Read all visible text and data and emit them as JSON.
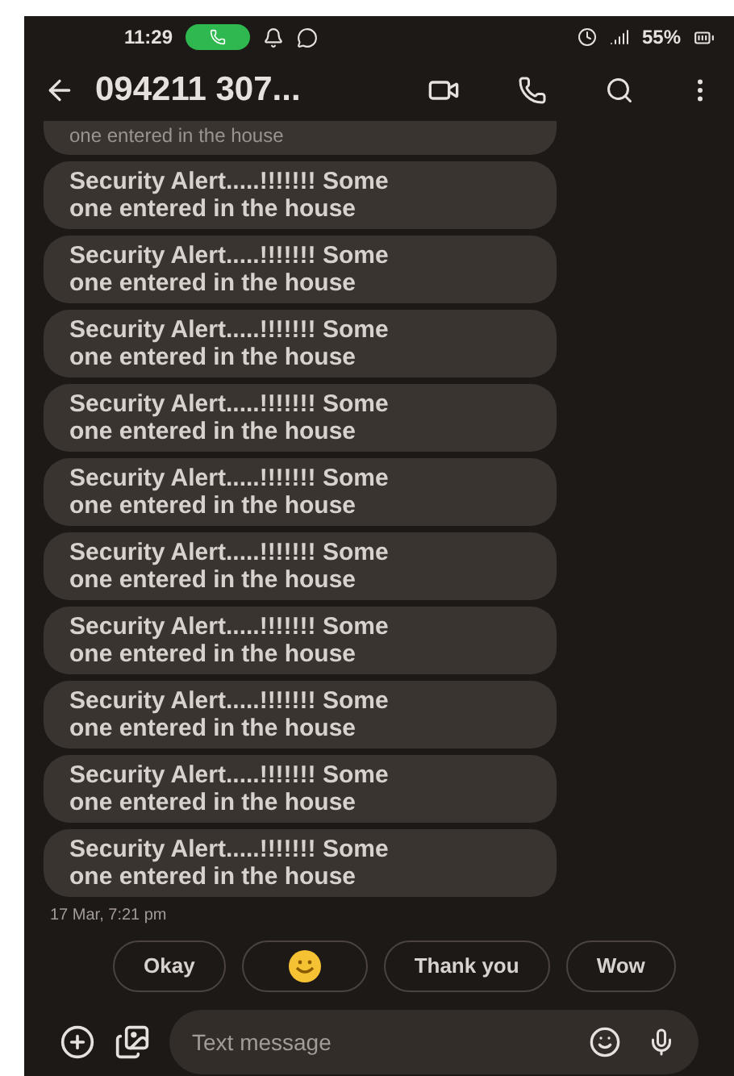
{
  "status_bar": {
    "time": "11:29",
    "battery": "55%"
  },
  "header": {
    "title": "094211 307..."
  },
  "messages": [
    {
      "text": "one entered in the house",
      "kind": "partial"
    },
    {
      "text": "Security Alert.....!!!!!!! Some one entered in the house",
      "kind": "full"
    },
    {
      "text": "Security Alert.....!!!!!!! Some one entered in the house",
      "kind": "full"
    },
    {
      "text": "Security Alert.....!!!!!!! Some one entered in the house",
      "kind": "full"
    },
    {
      "text": "Security Alert.....!!!!!!! Some one entered in the house",
      "kind": "full"
    },
    {
      "text": "Security Alert.....!!!!!!! Some one entered in the house",
      "kind": "full"
    },
    {
      "text": "Security Alert.....!!!!!!! Some one entered in the house",
      "kind": "full"
    },
    {
      "text": "Security Alert.....!!!!!!! Some one entered in the house",
      "kind": "full"
    },
    {
      "text": "Security Alert.....!!!!!!! Some one entered in the house",
      "kind": "full"
    },
    {
      "text": "Security Alert.....!!!!!!! Some one entered in the house",
      "kind": "full"
    },
    {
      "text": "Security Alert.....!!!!!!! Some one entered in the house",
      "kind": "full"
    }
  ],
  "timestamp": "17 Mar, 7:21 pm",
  "suggestions": [
    {
      "kind": "text",
      "label": "Okay"
    },
    {
      "kind": "emoji"
    },
    {
      "kind": "text",
      "label": "Thank you"
    },
    {
      "kind": "text",
      "label": "Wow"
    }
  ],
  "composer": {
    "placeholder": "Text message"
  }
}
